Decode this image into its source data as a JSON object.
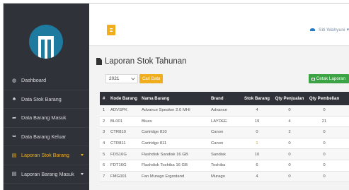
{
  "user": {
    "name": "Siti Wahyuni",
    "caret": "▾"
  },
  "sidebar": {
    "items": [
      {
        "label": "Dashboard",
        "icon": "dashboard-icon",
        "glyph": "◍",
        "active": false,
        "caret": false
      },
      {
        "label": "Data Stok Barang",
        "icon": "boxes-icon",
        "glyph": "♣",
        "active": false,
        "caret": false
      },
      {
        "label": "Data Barang Masuk",
        "icon": "share-icon",
        "glyph": "➦",
        "active": false,
        "caret": false
      },
      {
        "label": "Data Barang Keluar",
        "icon": "reply-icon",
        "glyph": "➥",
        "active": false,
        "caret": false
      },
      {
        "label": "Laporan Stok Barang",
        "icon": "file-icon",
        "glyph": "▤",
        "active": true,
        "caret": true
      },
      {
        "label": "Laporan Barang Masuk",
        "icon": "file-icon",
        "glyph": "▤",
        "active": false,
        "caret": true
      }
    ]
  },
  "page": {
    "title": "Laporan Stok Tahunan",
    "year": "2021",
    "search_label": "Cari Data",
    "print_label": "Cetak Laporan"
  },
  "table": {
    "headers": [
      "#",
      "Kode Barang",
      "Nama Barang",
      "Brand",
      "Stok Barang",
      "Qty Penjualan",
      "Qty Pembelian"
    ],
    "rows": [
      [
        "1",
        "ADVSPK",
        "Advance Speaker 2.0 MHI",
        "Advance",
        "4",
        "0",
        "0"
      ],
      [
        "2",
        "BL001",
        "Blues",
        "LAYDEE",
        "19",
        "4",
        "21"
      ],
      [
        "3",
        "CTR810",
        "Cartridge 810",
        "Canon",
        "0",
        "2",
        "0"
      ],
      [
        "4",
        "CTR811",
        "Cartridge 811",
        "Canon",
        "1",
        "0",
        "0"
      ],
      [
        "5",
        "FDS16G",
        "Flashdisk Sandisk 16 GB",
        "Sandisk",
        "10",
        "0",
        "0"
      ],
      [
        "6",
        "FDT16G",
        "Flashdisk Toshiba 16 GB",
        "Toshiba",
        "6",
        "0",
        "0"
      ],
      [
        "7",
        "FMG001",
        "Fan Murago Ergostand",
        "Murago",
        "4",
        "0",
        "0"
      ]
    ]
  },
  "colors": {
    "accent": "#f0ad1e",
    "sidebar": "#2f3238",
    "success": "#3ba343",
    "logo": "#1f7aa0"
  }
}
